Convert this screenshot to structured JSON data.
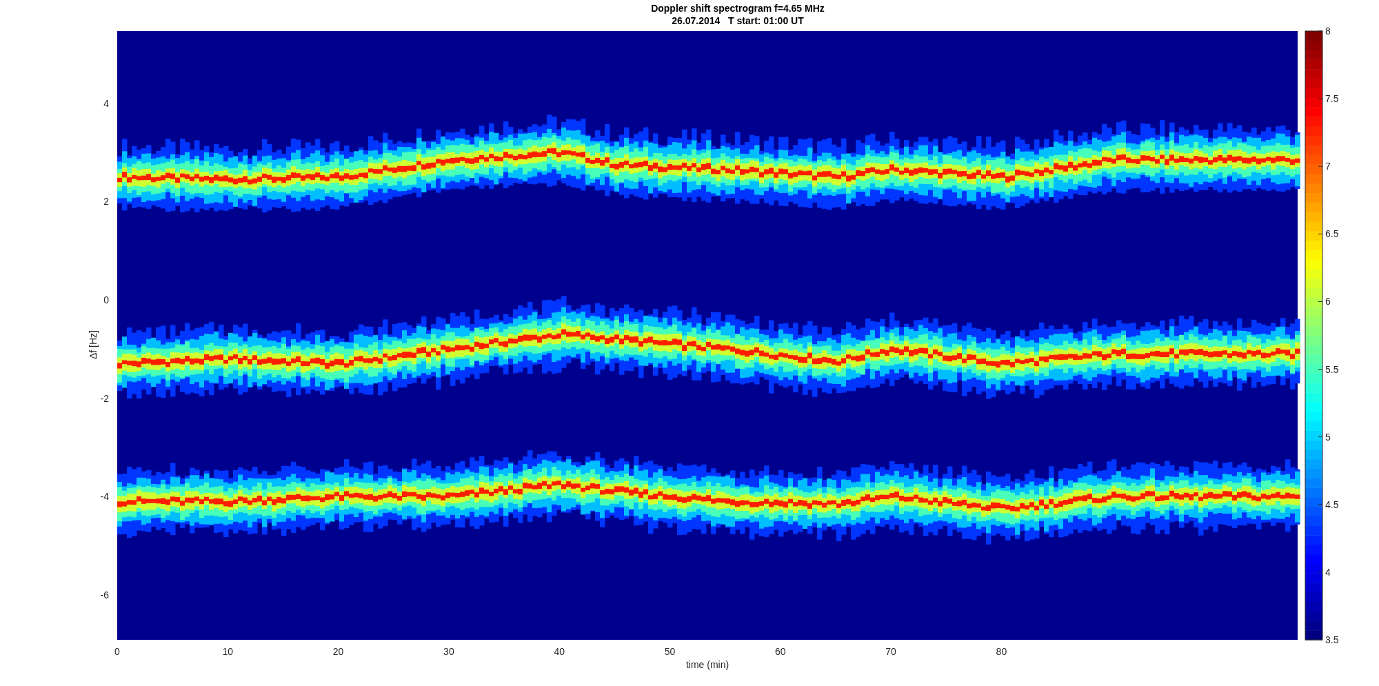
{
  "figure": {
    "title": "Doppler shift spectrogram f=4.65 MHz",
    "subtitle": "26.07.2014   T start: 01:00 UT"
  },
  "axes": {
    "xlabel": "time (min)",
    "ylabel": "Δf [Hz]",
    "xticks": [
      "0",
      "10",
      "20",
      "30",
      "40",
      "50",
      "60",
      "70",
      "80"
    ],
    "yticks": [
      "4",
      "2",
      "0",
      "-2",
      "-4",
      "-6"
    ]
  },
  "colorbar": {
    "ticks": [
      "8",
      "7.5",
      "7",
      "6.5",
      "6",
      "5.5",
      "5",
      "4.5",
      "4",
      "3.5"
    ]
  }
}
